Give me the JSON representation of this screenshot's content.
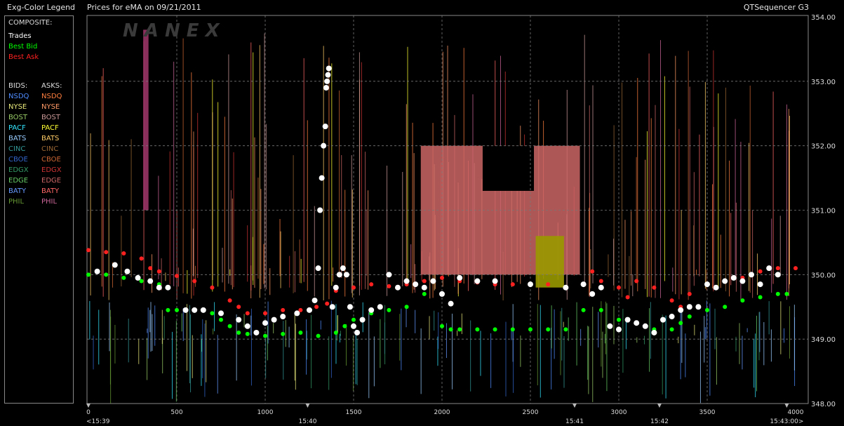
{
  "window": {
    "legend_title": "Exg-Color Legend",
    "chart_title": "Prices for  eMA  on 09/21/2011",
    "app_name": "QTSequencer G3"
  },
  "legend": {
    "composite_header": "COMPOSITE:",
    "composite": [
      {
        "label": "Trades",
        "color": "#ffffff"
      },
      {
        "label": "Best Bid",
        "color": "#00ff00"
      },
      {
        "label": "Best Ask",
        "color": "#ff2020"
      }
    ],
    "bids_header": "BIDS:",
    "asks_header": "ASKS:",
    "exchanges": [
      {
        "bid": "NSDQ",
        "ask": "NSDQ",
        "bid_color": "#4f8cff",
        "ask_color": "#ff7f3f"
      },
      {
        "bid": "NYSE",
        "ask": "NYSE",
        "bid_color": "#e6e67a",
        "ask_color": "#ff9966"
      },
      {
        "bid": "BOST",
        "ask": "BOST",
        "bid_color": "#99cc66",
        "ask_color": "#cc9999"
      },
      {
        "bid": "PACF",
        "ask": "PACF",
        "bid_color": "#33e6ff",
        "ask_color": "#ffff33"
      },
      {
        "bid": "BATS",
        "ask": "BATS",
        "bid_color": "#99ccff",
        "ask_color": "#ffcc66"
      },
      {
        "bid": "CINC",
        "ask": "CINC",
        "bid_color": "#339999",
        "ask_color": "#996633"
      },
      {
        "bid": "CBOE",
        "ask": "CBOE",
        "bid_color": "#3366cc",
        "ask_color": "#cc6633"
      },
      {
        "bid": "EDGX",
        "ask": "EDGX",
        "bid_color": "#339966",
        "ask_color": "#cc3333"
      },
      {
        "bid": "EDGE",
        "ask": "EDGE",
        "bid_color": "#66cc66",
        "ask_color": "#cc6666"
      },
      {
        "bid": "BATY",
        "ask": "BATY",
        "bid_color": "#6699ff",
        "ask_color": "#ff6666"
      },
      {
        "bid": "PHIL",
        "ask": "PHIL",
        "bid_color": "#669933",
        "ask_color": "#cc6699"
      }
    ]
  },
  "watermark": "N A N E X",
  "chart_data": {
    "type": "scatter",
    "title": "Prices for  eMA  on 09/21/2011",
    "xlim": [
      0,
      4000
    ],
    "ylim": [
      348,
      354
    ],
    "x_ticks": [
      0,
      500,
      1000,
      1500,
      2000,
      2500,
      3000,
      3500,
      4000
    ],
    "y_ticks": [
      348.0,
      349.0,
      350.0,
      351.0,
      352.0,
      353.0,
      354.0
    ],
    "y_tick_labels": [
      "348.00",
      "349.00",
      "350.00",
      "351.00",
      "352.00",
      "353.00",
      "354.00"
    ],
    "time_labels": [
      {
        "x": 0,
        "label": "<15:39"
      },
      {
        "x": 1240,
        "label": "15:40"
      },
      {
        "x": 2750,
        "label": "15:41"
      },
      {
        "x": 3230,
        "label": "15:42"
      },
      {
        "x": 3950,
        "label": "15:43:00>"
      }
    ],
    "grid": true,
    "series": [
      {
        "name": "Best Ask",
        "color": "#ff2020",
        "points": [
          [
            0,
            350.38
          ],
          [
            100,
            350.35
          ],
          [
            200,
            350.33
          ],
          [
            300,
            350.25
          ],
          [
            350,
            350.1
          ],
          [
            400,
            350.05
          ],
          [
            500,
            349.98
          ],
          [
            600,
            349.9
          ],
          [
            700,
            349.8
          ],
          [
            800,
            349.6
          ],
          [
            850,
            349.5
          ],
          [
            900,
            349.4
          ],
          [
            1000,
            349.4
          ],
          [
            1100,
            349.45
          ],
          [
            1200,
            349.45
          ],
          [
            1290,
            349.5
          ],
          [
            1350,
            349.55
          ],
          [
            1400,
            349.75
          ],
          [
            1500,
            349.8
          ],
          [
            1600,
            349.85
          ],
          [
            1700,
            349.82
          ],
          [
            1800,
            349.85
          ],
          [
            1900,
            349.9
          ],
          [
            2000,
            349.95
          ],
          [
            2100,
            349.9
          ],
          [
            2200,
            349.88
          ],
          [
            2300,
            349.85
          ],
          [
            2400,
            349.85
          ],
          [
            2500,
            349.85
          ],
          [
            2600,
            349.85
          ],
          [
            2700,
            349.8
          ],
          [
            2800,
            349.85
          ],
          [
            2850,
            350.05
          ],
          [
            2900,
            349.9
          ],
          [
            3000,
            349.8
          ],
          [
            3050,
            349.65
          ],
          [
            3100,
            349.9
          ],
          [
            3200,
            349.8
          ],
          [
            3300,
            349.6
          ],
          [
            3350,
            349.5
          ],
          [
            3400,
            349.7
          ],
          [
            3500,
            349.85
          ],
          [
            3600,
            349.9
          ],
          [
            3700,
            349.95
          ],
          [
            3800,
            350.05
          ],
          [
            3900,
            350.1
          ],
          [
            4000,
            350.1
          ]
        ]
      },
      {
        "name": "Best Bid",
        "color": "#00ff00",
        "points": [
          [
            0,
            350.0
          ],
          [
            100,
            350.0
          ],
          [
            200,
            349.95
          ],
          [
            300,
            349.9
          ],
          [
            400,
            349.85
          ],
          [
            450,
            349.45
          ],
          [
            500,
            349.45
          ],
          [
            600,
            349.45
          ],
          [
            700,
            349.4
          ],
          [
            750,
            349.3
          ],
          [
            800,
            349.2
          ],
          [
            850,
            349.1
          ],
          [
            900,
            349.08
          ],
          [
            1000,
            349.05
          ],
          [
            1100,
            349.08
          ],
          [
            1200,
            349.1
          ],
          [
            1300,
            349.05
          ],
          [
            1400,
            349.1
          ],
          [
            1450,
            349.2
          ],
          [
            1500,
            349.3
          ],
          [
            1600,
            349.4
          ],
          [
            1700,
            349.45
          ],
          [
            1800,
            349.5
          ],
          [
            1900,
            349.7
          ],
          [
            2000,
            349.2
          ],
          [
            2050,
            349.15
          ],
          [
            2100,
            349.15
          ],
          [
            2200,
            349.15
          ],
          [
            2300,
            349.15
          ],
          [
            2400,
            349.15
          ],
          [
            2500,
            349.15
          ],
          [
            2600,
            349.15
          ],
          [
            2700,
            349.15
          ],
          [
            2800,
            349.45
          ],
          [
            2900,
            349.45
          ],
          [
            3000,
            349.3
          ],
          [
            3100,
            349.25
          ],
          [
            3200,
            349.15
          ],
          [
            3300,
            349.15
          ],
          [
            3350,
            349.25
          ],
          [
            3400,
            349.35
          ],
          [
            3500,
            349.45
          ],
          [
            3600,
            349.5
          ],
          [
            3700,
            349.6
          ],
          [
            3800,
            349.65
          ],
          [
            3900,
            349.7
          ],
          [
            3950,
            349.7
          ]
        ]
      },
      {
        "name": "Trades",
        "color": "#ffffff",
        "points": [
          [
            50,
            350.05
          ],
          [
            150,
            350.15
          ],
          [
            220,
            350.05
          ],
          [
            280,
            349.95
          ],
          [
            350,
            349.9
          ],
          [
            400,
            349.8
          ],
          [
            450,
            349.8
          ],
          [
            550,
            349.45
          ],
          [
            600,
            349.45
          ],
          [
            650,
            349.45
          ],
          [
            750,
            349.4
          ],
          [
            850,
            349.3
          ],
          [
            900,
            349.2
          ],
          [
            950,
            349.1
          ],
          [
            1000,
            349.25
          ],
          [
            1050,
            349.3
          ],
          [
            1100,
            349.35
          ],
          [
            1180,
            349.4
          ],
          [
            1250,
            349.45
          ],
          [
            1280,
            349.6
          ],
          [
            1300,
            350.1
          ],
          [
            1310,
            351.0
          ],
          [
            1320,
            351.5
          ],
          [
            1330,
            352.0
          ],
          [
            1340,
            352.3
          ],
          [
            1345,
            352.9
          ],
          [
            1350,
            353.0
          ],
          [
            1355,
            353.1
          ],
          [
            1360,
            353.2
          ],
          [
            1380,
            349.5
          ],
          [
            1400,
            349.8
          ],
          [
            1420,
            350.0
          ],
          [
            1440,
            350.1
          ],
          [
            1460,
            350.0
          ],
          [
            1480,
            349.5
          ],
          [
            1500,
            349.2
          ],
          [
            1520,
            349.1
          ],
          [
            1550,
            349.3
          ],
          [
            1600,
            349.45
          ],
          [
            1650,
            349.5
          ],
          [
            1700,
            350.0
          ],
          [
            1750,
            349.8
          ],
          [
            1800,
            349.9
          ],
          [
            1850,
            349.85
          ],
          [
            1900,
            349.8
          ],
          [
            1950,
            349.9
          ],
          [
            2000,
            349.7
          ],
          [
            2050,
            349.55
          ],
          [
            2100,
            349.95
          ],
          [
            2200,
            349.9
          ],
          [
            2300,
            349.9
          ],
          [
            2500,
            349.85
          ],
          [
            2700,
            349.8
          ],
          [
            2800,
            349.85
          ],
          [
            2850,
            349.7
          ],
          [
            2900,
            349.8
          ],
          [
            2950,
            349.2
          ],
          [
            3000,
            349.15
          ],
          [
            3050,
            349.3
          ],
          [
            3100,
            349.25
          ],
          [
            3150,
            349.2
          ],
          [
            3200,
            349.1
          ],
          [
            3250,
            349.3
          ],
          [
            3300,
            349.35
          ],
          [
            3350,
            349.45
          ],
          [
            3400,
            349.5
          ],
          [
            3450,
            349.5
          ],
          [
            3500,
            349.85
          ],
          [
            3550,
            349.8
          ],
          [
            3600,
            349.9
          ],
          [
            3650,
            349.95
          ],
          [
            3700,
            349.9
          ],
          [
            3750,
            350.0
          ],
          [
            3800,
            349.85
          ],
          [
            3850,
            350.1
          ],
          [
            3900,
            350.0
          ]
        ]
      }
    ]
  }
}
